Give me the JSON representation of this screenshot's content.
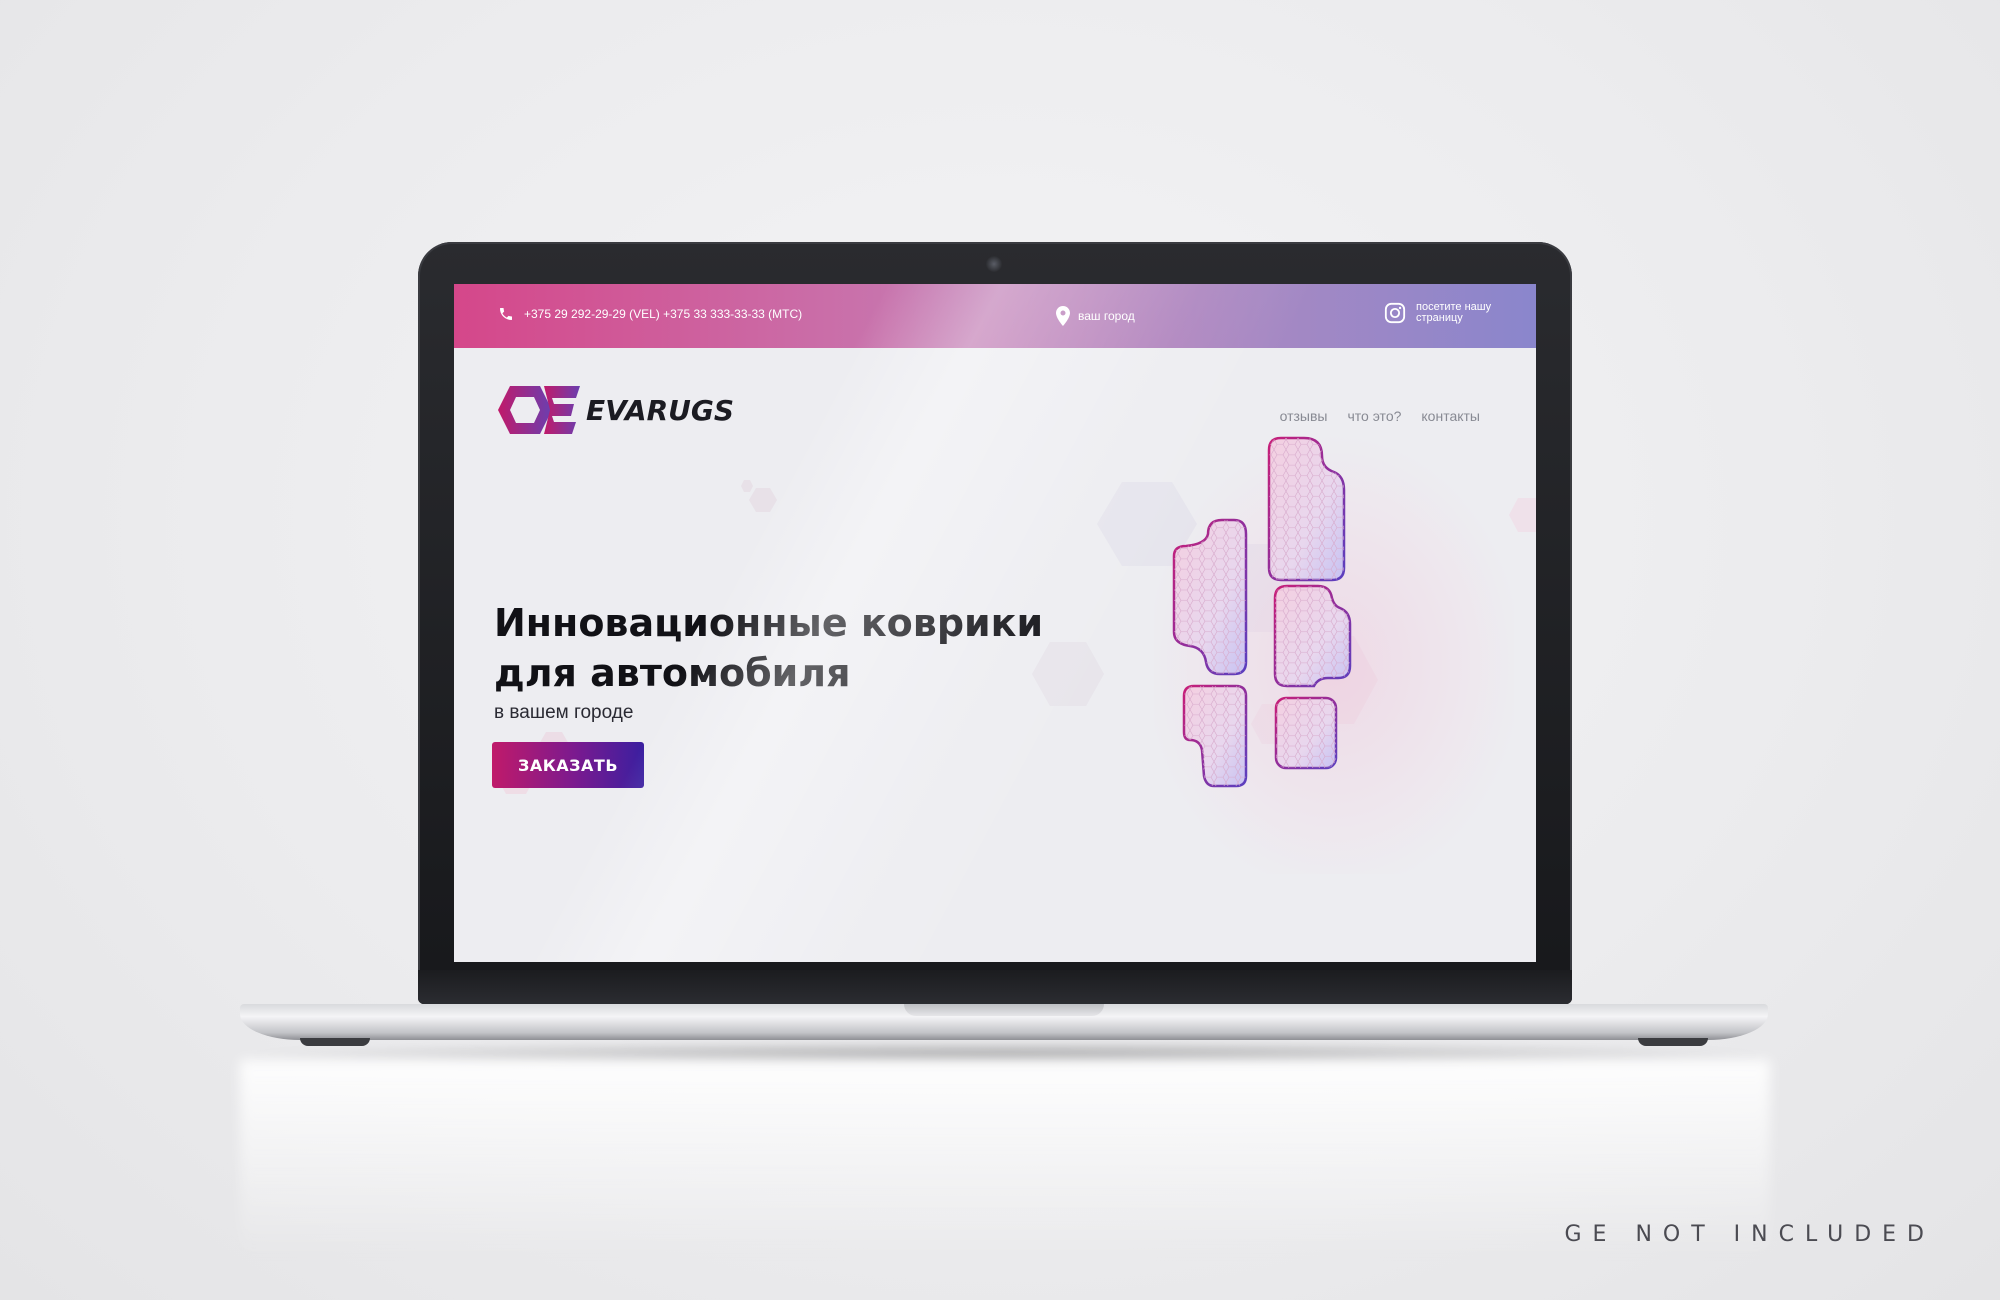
{
  "topbar": {
    "phone_text": "+375 29 292-29-29 (VEL) +375 33 333-33-33 (MTC)",
    "city_text": "ваш город",
    "instagram_text": "посетите нашу страницу"
  },
  "header": {
    "logo_text": "EVARUGS",
    "nav": [
      "отзывы",
      "что это?",
      "контакты"
    ]
  },
  "hero": {
    "title": "Инновационные коврики для автомобиля",
    "subtitle": "в вашем городе",
    "cta_label": "ЗАКАЗАТЬ"
  },
  "watermark": "GE NOT INCLUDED",
  "icons": {
    "phone": "phone-icon",
    "city": "location-pin-icon",
    "instagram": "instagram-icon",
    "logo": "hexagon-e-logo"
  },
  "colors": {
    "accent_pink": "#d5478a",
    "accent_violet": "#8a86cc",
    "cta_start": "#c01a6a",
    "cta_end": "#3a1fa0"
  }
}
